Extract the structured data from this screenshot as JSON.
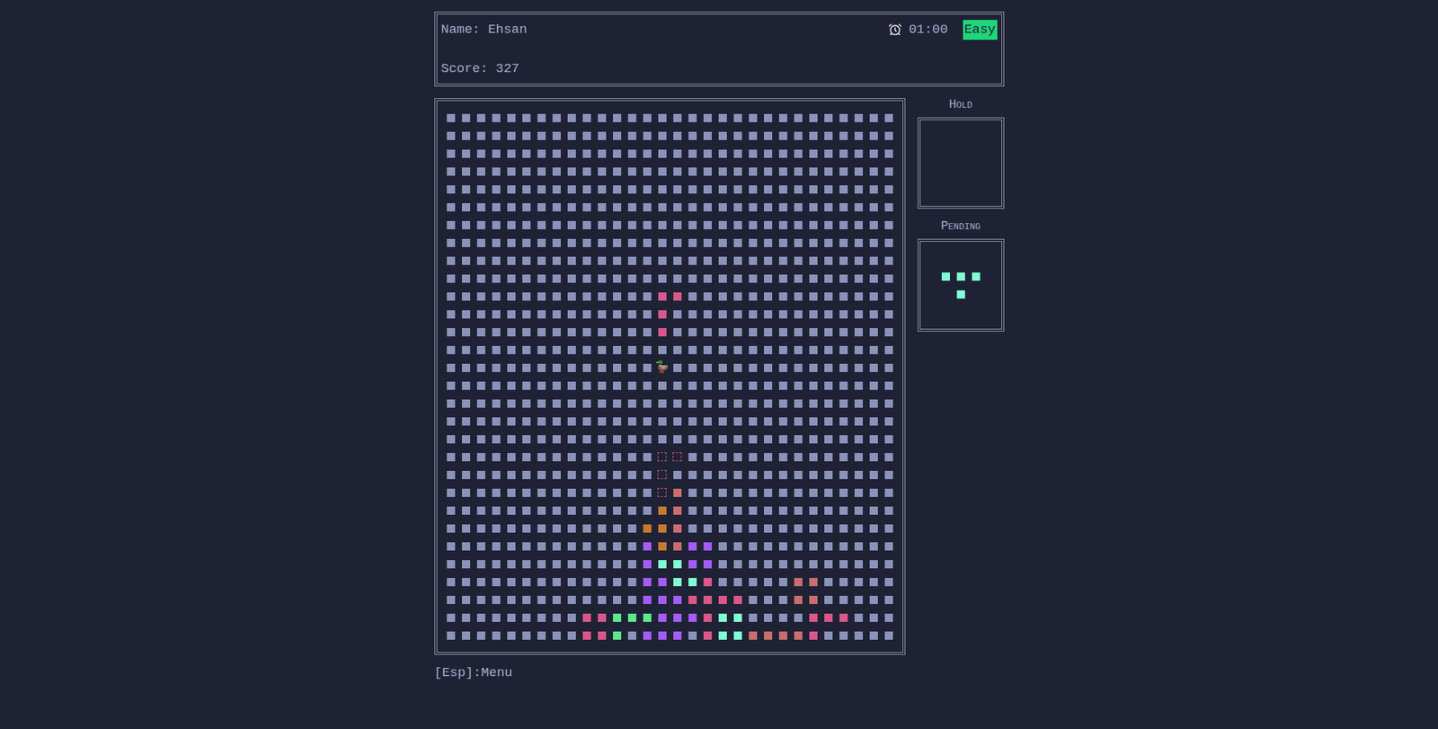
{
  "header": {
    "name_label": "Name: Ehsan",
    "score_label": "Score: 327",
    "time": "01:00",
    "difficulty": "Easy"
  },
  "board": {
    "cols": 30,
    "rows": 30,
    "player": {
      "glyph": "🦆",
      "row": 14,
      "col": 14
    },
    "cells": [
      {
        "row": 10,
        "col": 14,
        "color": "#d9578a",
        "kind": "falling"
      },
      {
        "row": 10,
        "col": 15,
        "color": "#d9578a",
        "kind": "falling"
      },
      {
        "row": 11,
        "col": 14,
        "color": "#d9578a",
        "kind": "falling"
      },
      {
        "row": 12,
        "col": 14,
        "color": "#d9578a",
        "kind": "falling"
      },
      {
        "row": 19,
        "col": 14,
        "color": "#d9578a",
        "kind": "ghost"
      },
      {
        "row": 19,
        "col": 15,
        "color": "#d9578a",
        "kind": "ghost"
      },
      {
        "row": 20,
        "col": 14,
        "color": "#d9578a",
        "kind": "ghost"
      },
      {
        "row": 21,
        "col": 14,
        "color": "#d9578a",
        "kind": "ghost"
      },
      {
        "row": 21,
        "col": 15,
        "color": "#c96e6e",
        "kind": "block"
      },
      {
        "row": 22,
        "col": 14,
        "color": "#c57a2e",
        "kind": "block"
      },
      {
        "row": 22,
        "col": 15,
        "color": "#c96e6e",
        "kind": "block"
      },
      {
        "row": 23,
        "col": 13,
        "color": "#c57a2e",
        "kind": "block"
      },
      {
        "row": 23,
        "col": 14,
        "color": "#c57a2e",
        "kind": "block"
      },
      {
        "row": 23,
        "col": 15,
        "color": "#c96e6e",
        "kind": "block"
      },
      {
        "row": 24,
        "col": 13,
        "color": "#a45cf5",
        "kind": "block"
      },
      {
        "row": 24,
        "col": 14,
        "color": "#c57a2e",
        "kind": "block"
      },
      {
        "row": 24,
        "col": 15,
        "color": "#c96e6e",
        "kind": "block"
      },
      {
        "row": 24,
        "col": 16,
        "color": "#a45cf5",
        "kind": "block"
      },
      {
        "row": 24,
        "col": 17,
        "color": "#a45cf5",
        "kind": "block"
      },
      {
        "row": 25,
        "col": 13,
        "color": "#a45cf5",
        "kind": "block"
      },
      {
        "row": 25,
        "col": 14,
        "color": "#7fffd4",
        "kind": "block"
      },
      {
        "row": 25,
        "col": 15,
        "color": "#7fffd4",
        "kind": "block"
      },
      {
        "row": 25,
        "col": 16,
        "color": "#a45cf5",
        "kind": "block"
      },
      {
        "row": 25,
        "col": 17,
        "color": "#a45cf5",
        "kind": "block"
      },
      {
        "row": 26,
        "col": 13,
        "color": "#a45cf5",
        "kind": "block"
      },
      {
        "row": 26,
        "col": 14,
        "color": "#a45cf5",
        "kind": "block"
      },
      {
        "row": 26,
        "col": 15,
        "color": "#7fffd4",
        "kind": "block"
      },
      {
        "row": 26,
        "col": 16,
        "color": "#7fffd4",
        "kind": "block"
      },
      {
        "row": 26,
        "col": 17,
        "color": "#d9578a",
        "kind": "block"
      },
      {
        "row": 26,
        "col": 23,
        "color": "#c96e6e",
        "kind": "block"
      },
      {
        "row": 26,
        "col": 24,
        "color": "#c96e6e",
        "kind": "block"
      },
      {
        "row": 27,
        "col": 13,
        "color": "#a45cf5",
        "kind": "block"
      },
      {
        "row": 27,
        "col": 14,
        "color": "#a45cf5",
        "kind": "block"
      },
      {
        "row": 27,
        "col": 15,
        "color": "#a45cf5",
        "kind": "block"
      },
      {
        "row": 27,
        "col": 16,
        "color": "#d9578a",
        "kind": "block"
      },
      {
        "row": 27,
        "col": 17,
        "color": "#d9578a",
        "kind": "block"
      },
      {
        "row": 27,
        "col": 18,
        "color": "#d9578a",
        "kind": "block"
      },
      {
        "row": 27,
        "col": 19,
        "color": "#d9578a",
        "kind": "block"
      },
      {
        "row": 27,
        "col": 23,
        "color": "#c96e6e",
        "kind": "block"
      },
      {
        "row": 27,
        "col": 24,
        "color": "#c96e6e",
        "kind": "block"
      },
      {
        "row": 28,
        "col": 9,
        "color": "#d9578a",
        "kind": "block"
      },
      {
        "row": 28,
        "col": 10,
        "color": "#d9578a",
        "kind": "block"
      },
      {
        "row": 28,
        "col": 11,
        "color": "#5de88a",
        "kind": "block"
      },
      {
        "row": 28,
        "col": 12,
        "color": "#5de88a",
        "kind": "block"
      },
      {
        "row": 28,
        "col": 13,
        "color": "#5de88a",
        "kind": "block"
      },
      {
        "row": 28,
        "col": 14,
        "color": "#a45cf5",
        "kind": "block"
      },
      {
        "row": 28,
        "col": 15,
        "color": "#a45cf5",
        "kind": "block"
      },
      {
        "row": 28,
        "col": 16,
        "color": "#a45cf5",
        "kind": "block"
      },
      {
        "row": 28,
        "col": 17,
        "color": "#d9578a",
        "kind": "block"
      },
      {
        "row": 28,
        "col": 18,
        "color": "#7fffd4",
        "kind": "block"
      },
      {
        "row": 28,
        "col": 19,
        "color": "#7fffd4",
        "kind": "block"
      },
      {
        "row": 28,
        "col": 24,
        "color": "#d9578a",
        "kind": "block"
      },
      {
        "row": 28,
        "col": 25,
        "color": "#d9578a",
        "kind": "block"
      },
      {
        "row": 28,
        "col": 26,
        "color": "#d9578a",
        "kind": "block"
      },
      {
        "row": 29,
        "col": 9,
        "color": "#d9578a",
        "kind": "block"
      },
      {
        "row": 29,
        "col": 10,
        "color": "#d9578a",
        "kind": "block"
      },
      {
        "row": 29,
        "col": 11,
        "color": "#5de88a",
        "kind": "block"
      },
      {
        "row": 29,
        "col": 13,
        "color": "#a45cf5",
        "kind": "block"
      },
      {
        "row": 29,
        "col": 14,
        "color": "#a45cf5",
        "kind": "block"
      },
      {
        "row": 29,
        "col": 15,
        "color": "#a45cf5",
        "kind": "block"
      },
      {
        "row": 29,
        "col": 17,
        "color": "#d9578a",
        "kind": "block"
      },
      {
        "row": 29,
        "col": 18,
        "color": "#7fffd4",
        "kind": "block"
      },
      {
        "row": 29,
        "col": 19,
        "color": "#7fffd4",
        "kind": "block"
      },
      {
        "row": 29,
        "col": 20,
        "color": "#c96e6e",
        "kind": "block"
      },
      {
        "row": 29,
        "col": 21,
        "color": "#c96e6e",
        "kind": "block"
      },
      {
        "row": 29,
        "col": 22,
        "color": "#c96e6e",
        "kind": "block"
      },
      {
        "row": 29,
        "col": 23,
        "color": "#c96e6e",
        "kind": "block"
      },
      {
        "row": 29,
        "col": 24,
        "color": "#d9578a",
        "kind": "block"
      }
    ]
  },
  "hold": {
    "label": "Hold",
    "cells": []
  },
  "pending": {
    "label": "Pending",
    "color": "#7fffd4",
    "cols": 3,
    "rows": 2,
    "cells": [
      {
        "row": 0,
        "col": 0
      },
      {
        "row": 0,
        "col": 1
      },
      {
        "row": 0,
        "col": 2
      },
      {
        "row": 1,
        "col": 1
      }
    ]
  },
  "footer": {
    "hint": "[Esp]:Menu"
  }
}
